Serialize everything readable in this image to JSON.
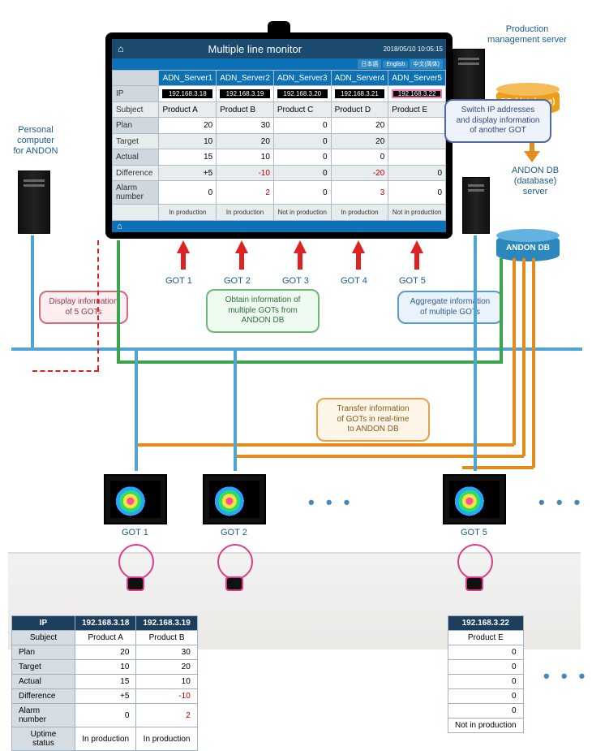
{
  "monitor": {
    "title": "Multiple line monitor",
    "datetime": "2018/05/10 10:05:15",
    "langs": [
      "日本語",
      "English",
      "中文(简体)"
    ],
    "servers": [
      "ADN_Server1",
      "ADN_Server2",
      "ADN_Server3",
      "ADN_Server4",
      "ADN_Server5"
    ],
    "rows": {
      "ip": [
        "192.168.3.18",
        "192.168.3.19",
        "192.168.3.20",
        "192.168.3.21",
        "192.168.3.22"
      ],
      "subject": [
        "Product A",
        "Product B",
        "Product C",
        "Product D",
        "Product E"
      ],
      "plan": [
        "20",
        "30",
        "0",
        "20",
        " "
      ],
      "target": [
        "10",
        "20",
        "0",
        "20",
        " "
      ],
      "actual": [
        "15",
        "10",
        "0",
        "0",
        " "
      ],
      "difference": [
        "+5",
        "-10",
        "0",
        "-20",
        "0"
      ],
      "alarm": [
        "0",
        "2",
        "0",
        "3",
        "0"
      ],
      "status": [
        "In production",
        "In production",
        "Not in production",
        "In production",
        "Not in production"
      ]
    },
    "labels": {
      "ip": "IP",
      "subject": "Subject",
      "plan": "Plan",
      "target": "Target",
      "actual": "Actual",
      "difference": "Difference",
      "alarm": "Alarm number"
    }
  },
  "got_labels": [
    "GOT 1",
    "GOT 2",
    "GOT 3",
    "GOT 4",
    "GOT 5"
  ],
  "sideLabels": {
    "pc_andon": "Personal\ncomputer\nfor ANDON",
    "prod_srv": "Production\nmanagement server",
    "db_orange": "DB (database)",
    "andon_srv": "ANDON DB\n(database)\nserver",
    "db_blue": "ANDON DB"
  },
  "bubbles": {
    "switch_ip": "Switch IP addresses\nand display information\nof another GOT",
    "display5": "Display information\nof 5 GOTs",
    "obtain": "Obtain information of\nmultiple GOTs from\nANDON DB",
    "aggregate": "Aggregate information\nof multiple GOTs",
    "transfer": "Transfer information\nof GOTs in real-time\nto ANDON DB"
  },
  "got_dev_labels": [
    "GOT 1",
    "GOT 2",
    "GOT 5"
  ],
  "summaryLeft": {
    "headers": [
      "IP",
      "192.168.3.18",
      "192.168.3.19"
    ],
    "rows": [
      {
        "lab": "Subject",
        "v": [
          "Product A",
          "Product B"
        ],
        "cls": "subj"
      },
      {
        "lab": "Plan",
        "v": [
          "20",
          "30"
        ]
      },
      {
        "lab": "Target",
        "v": [
          "10",
          "20"
        ]
      },
      {
        "lab": "Actual",
        "v": [
          "15",
          "10"
        ]
      },
      {
        "lab": "Difference",
        "v": [
          "+5",
          "-10"
        ],
        "neg": [
          false,
          true
        ]
      },
      {
        "lab": "Alarm number",
        "v": [
          "0",
          "2"
        ],
        "neg": [
          false,
          true
        ]
      },
      {
        "lab": "Uptime status",
        "v": [
          "In production",
          "In production"
        ],
        "cls": "subj"
      }
    ]
  },
  "summaryRight": {
    "headers": [
      "192.168.3.22"
    ],
    "rows": [
      {
        "lab": "",
        "v": [
          "Product E"
        ],
        "cls": "subj"
      },
      {
        "lab": "",
        "v": [
          "0"
        ]
      },
      {
        "lab": "",
        "v": [
          "0"
        ]
      },
      {
        "lab": "",
        "v": [
          "0"
        ]
      },
      {
        "lab": "",
        "v": [
          "0"
        ]
      },
      {
        "lab": "",
        "v": [
          "0"
        ]
      },
      {
        "lab": "",
        "v": [
          "Not in production"
        ],
        "cls": "subj"
      }
    ]
  }
}
